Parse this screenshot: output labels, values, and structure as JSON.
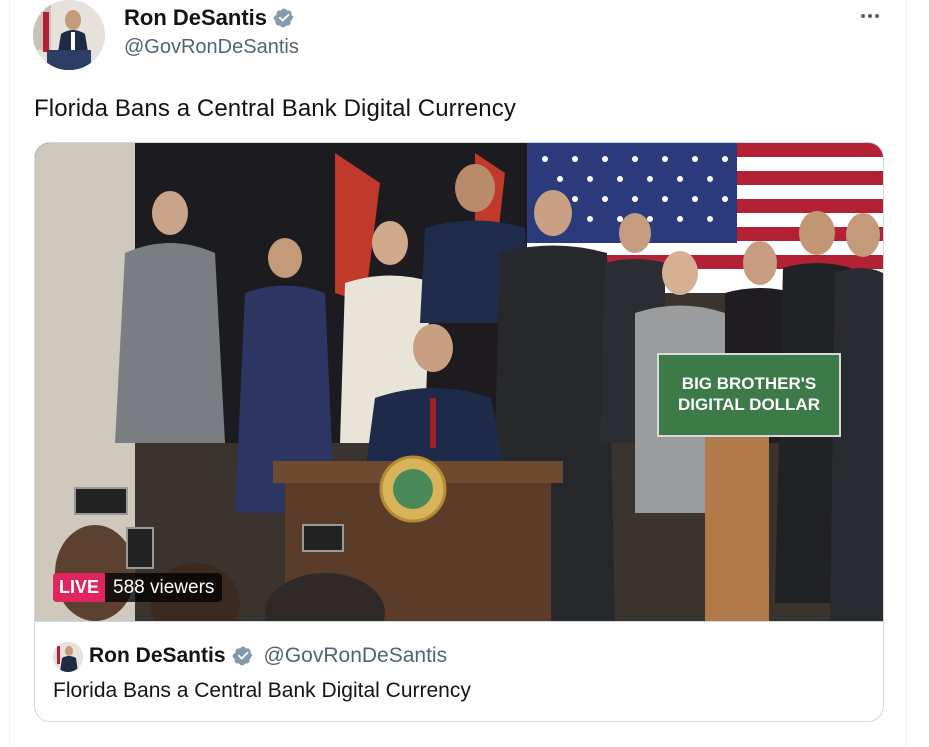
{
  "author": {
    "name": "Ron DeSantis",
    "handle": "@GovRonDeSantis",
    "verified_icon": "verified-badge-icon"
  },
  "tweet": {
    "text": "Florida Bans a Central Bank Digital Currency"
  },
  "media": {
    "live_label": "LIVE",
    "viewers": "588 viewers",
    "sign_line1": "BIG BROTHER'S",
    "sign_line2": "DIGITAL DOLLAR"
  },
  "quote": {
    "name": "Ron DeSantis",
    "handle": "@GovRonDeSantis",
    "text": "Florida Bans a Central Bank Digital Currency"
  },
  "colors": {
    "verified": "#829aab",
    "live": "#e0245e",
    "sign": "#3c7a48"
  }
}
